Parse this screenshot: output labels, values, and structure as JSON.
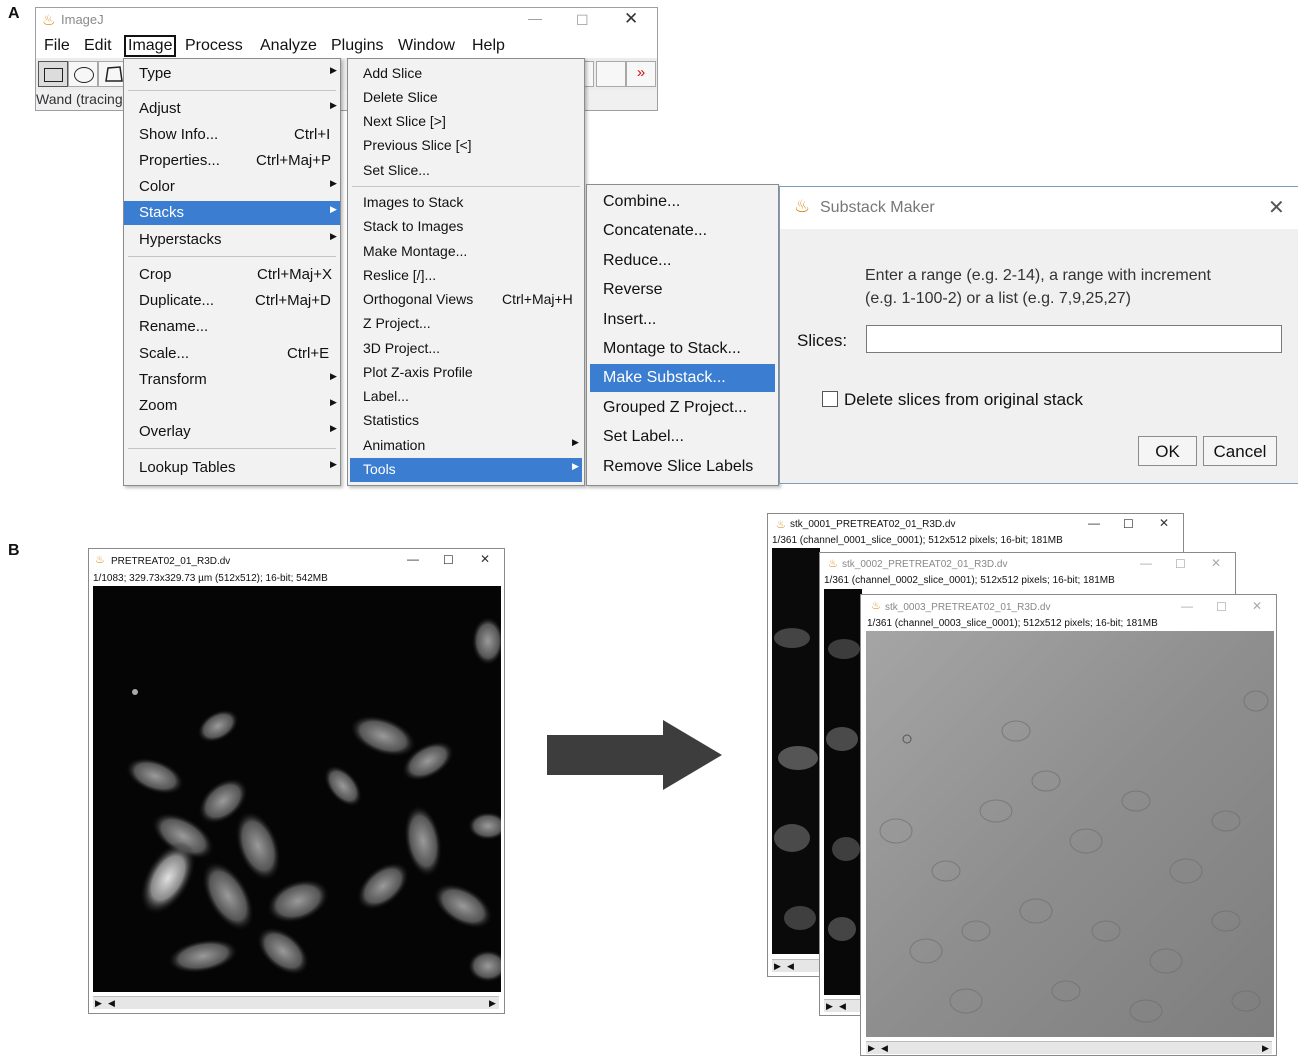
{
  "panels": {
    "a": "A",
    "b": "B"
  },
  "imagej": {
    "title": "ImageJ",
    "menubar": [
      "File",
      "Edit",
      "Image",
      "Process",
      "Analyze",
      "Plugins",
      "Window",
      "Help"
    ],
    "status": "Wand (tracing",
    "more_tools": "»"
  },
  "image_menu": [
    {
      "label": "Type",
      "sub": true
    },
    {
      "label": "Adjust",
      "sub": true
    },
    {
      "label": "Show Info...",
      "shortcut": "Ctrl+I"
    },
    {
      "label": "Properties...",
      "shortcut": "Ctrl+Maj+P"
    },
    {
      "label": "Color",
      "sub": true
    },
    {
      "label": "Stacks",
      "sub": true,
      "highlighted": true
    },
    {
      "label": "Hyperstacks",
      "sub": true
    },
    {
      "label": "Crop",
      "shortcut": "Ctrl+Maj+X"
    },
    {
      "label": "Duplicate...",
      "shortcut": "Ctrl+Maj+D"
    },
    {
      "label": "Rename..."
    },
    {
      "label": "Scale...",
      "shortcut": "Ctrl+E"
    },
    {
      "label": "Transform",
      "sub": true
    },
    {
      "label": "Zoom",
      "sub": true
    },
    {
      "label": "Overlay",
      "sub": true
    },
    {
      "label": "Lookup Tables",
      "sub": true
    }
  ],
  "stacks_menu": [
    {
      "label": "Add Slice"
    },
    {
      "label": "Delete Slice"
    },
    {
      "label": "Next Slice [>]"
    },
    {
      "label": "Previous Slice [<]"
    },
    {
      "label": "Set Slice..."
    },
    {
      "label": "Images to Stack"
    },
    {
      "label": "Stack to Images"
    },
    {
      "label": "Make Montage..."
    },
    {
      "label": "Reslice [/]..."
    },
    {
      "label": "Orthogonal Views",
      "shortcut": "Ctrl+Maj+H"
    },
    {
      "label": "Z Project..."
    },
    {
      "label": "3D Project..."
    },
    {
      "label": "Plot Z-axis Profile"
    },
    {
      "label": "Label..."
    },
    {
      "label": "Statistics"
    },
    {
      "label": "Animation",
      "sub": true
    },
    {
      "label": "Tools",
      "sub": true,
      "highlighted": true
    }
  ],
  "tools_menu": [
    {
      "label": "Combine..."
    },
    {
      "label": "Concatenate..."
    },
    {
      "label": "Reduce..."
    },
    {
      "label": "Reverse"
    },
    {
      "label": "Insert..."
    },
    {
      "label": "Montage to Stack..."
    },
    {
      "label": "Make Substack...",
      "highlighted": true
    },
    {
      "label": "Grouped Z Project..."
    },
    {
      "label": "Set Label..."
    },
    {
      "label": "Remove Slice Labels"
    }
  ],
  "substack_dialog": {
    "title": "Substack Maker",
    "instructions_line1": "Enter a range (e.g. 2-14), a range with increment",
    "instructions_line2": "(e.g. 1-100-2) or a list (e.g. 7,9,25,27)",
    "slices_label": "Slices:",
    "slices_value": "",
    "checkbox_label": "Delete slices from original stack",
    "checkbox_checked": false,
    "ok": "OK",
    "cancel": "Cancel"
  },
  "source_window": {
    "title": "PRETREAT02_01_R3D.dv",
    "info": "1/1083; 329.73x329.73 µm (512x512); 16-bit; 542MB"
  },
  "result_windows": [
    {
      "title": "stk_0001_PRETREAT02_01_R3D.dv",
      "info": "1/361 (channel_0001_slice_0001); 512x512 pixels; 16-bit; 181MB"
    },
    {
      "title": "stk_0002_PRETREAT02_01_R3D.dv",
      "info": "1/361 (channel_0002_slice_0001); 512x512 pixels; 16-bit; 181MB"
    },
    {
      "title": "stk_0003_PRETREAT02_01_R3D.dv",
      "info": "1/361 (channel_0003_slice_0001); 512x512 pixels; 16-bit; 181MB"
    }
  ],
  "colors": {
    "highlight": "#3a7dd1",
    "arrow": "#3d3d3d"
  }
}
